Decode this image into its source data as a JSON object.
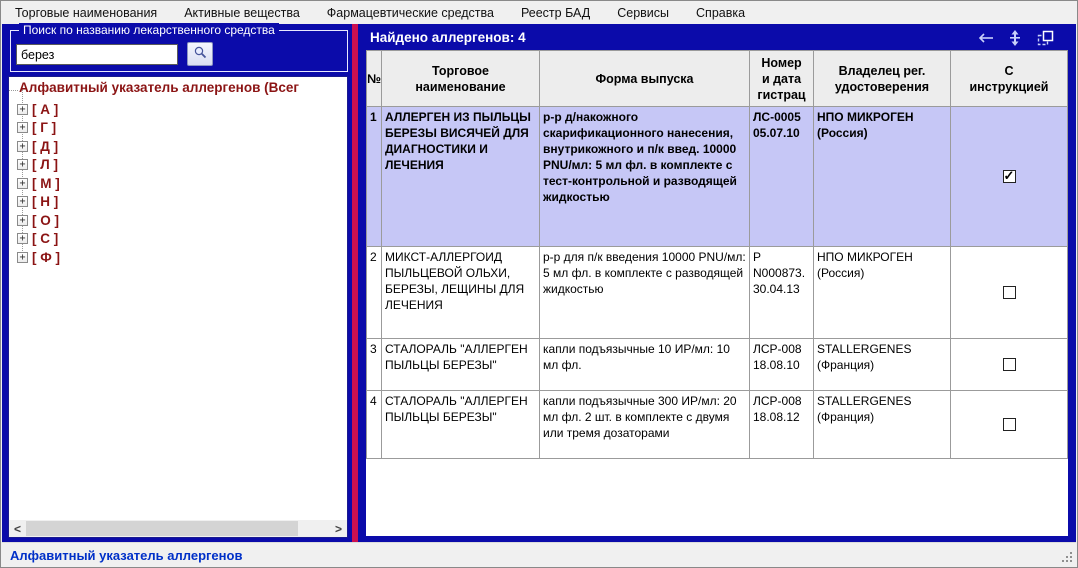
{
  "menu_bar": {
    "items": [
      {
        "label": "Торговые наименования"
      },
      {
        "label": "Активные вещества"
      },
      {
        "label": "Фармацевтические средства"
      },
      {
        "label": "Реестр БАД"
      },
      {
        "label": "Сервисы"
      },
      {
        "label": "Справка"
      }
    ]
  },
  "left_panel": {
    "search_group": {
      "label": "Поиск по названию лекарственного средства",
      "input_value": "берез",
      "button_icon": "magnifier-icon"
    },
    "tree": {
      "root_label": "Алфавитный указатель аллергенов (Всег",
      "expander_glyph": "+",
      "items": [
        {
          "label": "[ А ]"
        },
        {
          "label": "[ Г ]"
        },
        {
          "label": "[ Д ]"
        },
        {
          "label": "[ Л ]"
        },
        {
          "label": "[ М ]"
        },
        {
          "label": "[ Н ]"
        },
        {
          "label": "[ О ]"
        },
        {
          "label": "[ С ]"
        },
        {
          "label": "[ Ф ]"
        }
      ]
    }
  },
  "results_panel": {
    "title": "Найдено аллергенов: 4",
    "toolbar": {
      "back_icon": "left-arrow",
      "fit_icon": "fit-height-arrows",
      "windows_icon": "cascade-windows"
    },
    "table": {
      "columns": [
        "№",
        "Торговое\nнаименование",
        "Форма выпуска",
        "Номер\nи дата\nгистрац",
        "Владелец рег.\nудостоверения",
        "С\nинструкцией"
      ],
      "rows": [
        {
          "num": "1",
          "trade_name": "АЛЛЕРГЕН ИЗ ПЫЛЬЦЫ БЕРЕЗЫ ВИСЯЧЕЙ ДЛЯ ДИАГНОСТИКИ И ЛЕЧЕНИЯ",
          "release_form": "р-р д/накожного скарификационного нанесения, внутрикожного и п/к введ. 10000 PNU/мл: 5 мл фл. в комплекте с тест-контрольной и разводящей жидкостью",
          "reg_number": "ЛС-0005\n05.07.10",
          "owner": "НПО МИКРОГЕН (Россия)",
          "with_instruction": true,
          "selected": true
        },
        {
          "num": "2",
          "trade_name": "МИКСТ-АЛЛЕРГОИД ПЫЛЬЦЕВОЙ ОЛЬХИ, БЕРЕЗЫ, ЛЕЩИНЫ ДЛЯ ЛЕЧЕНИЯ",
          "release_form": "р-р для п/к введения 10000 PNU/мл: 5 мл фл. в комплекте с разводящей жидкостью",
          "reg_number": "Р\nN000873.\n30.04.13",
          "owner": "НПО МИКРОГЕН (Россия)",
          "with_instruction": false,
          "selected": false
        },
        {
          "num": "3",
          "trade_name": "СТАЛОРАЛЬ \"АЛЛЕРГЕН ПЫЛЬЦЫ БЕРЕЗЫ\"",
          "release_form": "капли подъязычные 10 ИР/мл: 10 мл фл.",
          "reg_number": "ЛСР-008\n18.08.10",
          "owner": "STALLERGENES (Франция)",
          "with_instruction": false,
          "selected": false
        },
        {
          "num": "4",
          "trade_name": "СТАЛОРАЛЬ \"АЛЛЕРГЕН ПЫЛЬЦЫ БЕРЕЗЫ\"",
          "release_form": "капли подъязычные 300 ИР/мл: 20 мл фл. 2 шт. в комплекте с двумя или тремя дозаторами",
          "reg_number": "ЛСР-008\n18.08.12",
          "owner": "STALLERGENES (Франция)",
          "with_instruction": false,
          "selected": false
        }
      ]
    }
  },
  "status_bar": {
    "text": "Алфавитный указатель аллергенов"
  },
  "colors": {
    "panel_blue": "#0b0baa",
    "splitter_red": "#cc1050",
    "selected_row": "#c6c7f6",
    "tree_text": "#8b1414",
    "status_text": "#0030c8",
    "header_bg": "#ededed"
  }
}
